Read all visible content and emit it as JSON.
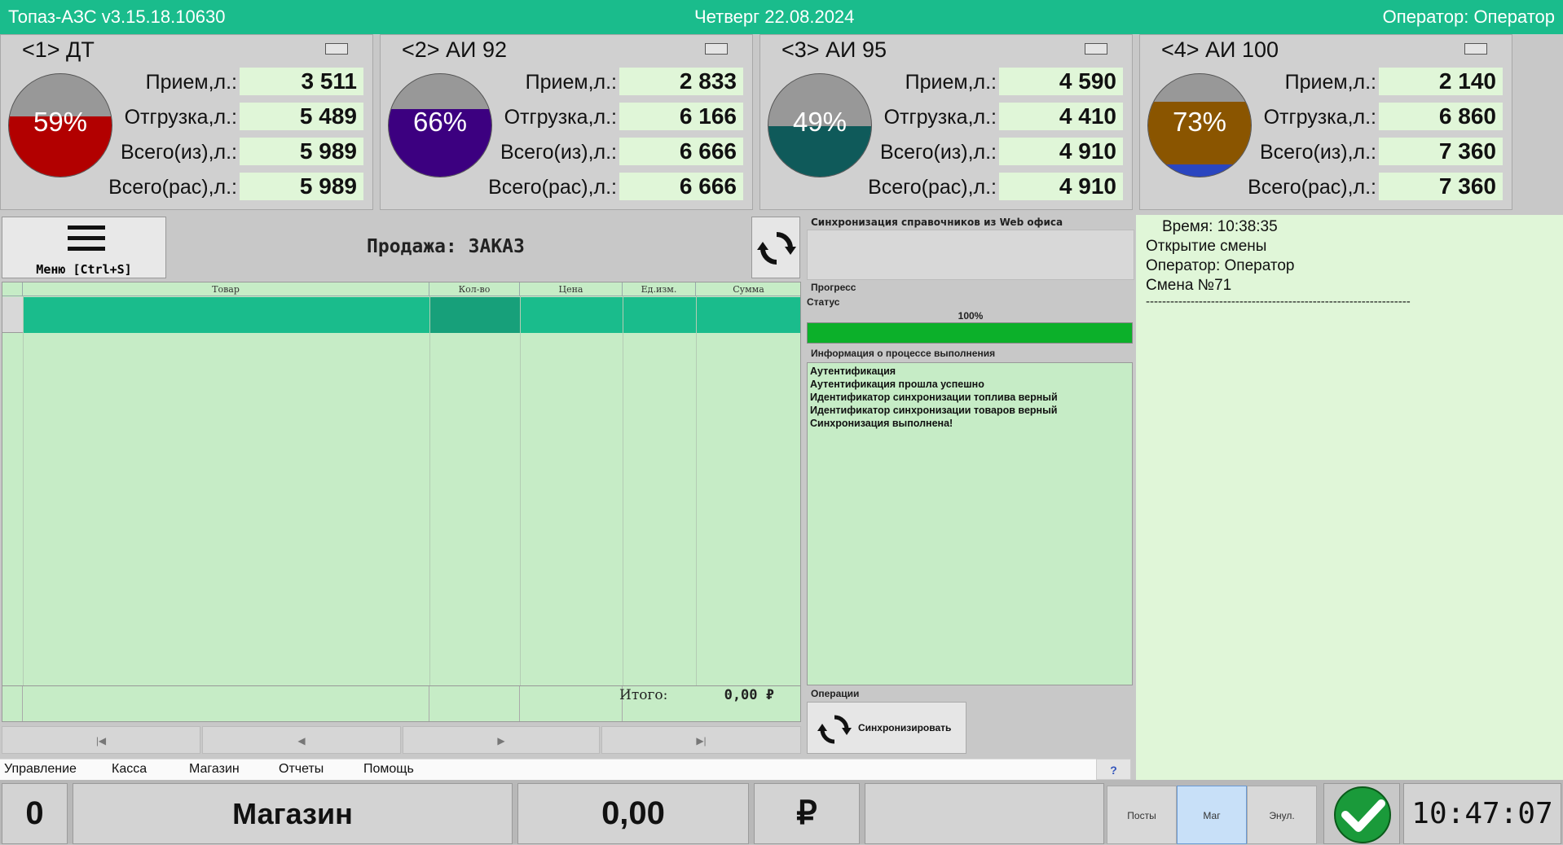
{
  "titlebar": {
    "app": "Топаз-АЗС  v3.15.18.10630",
    "date": "Четверг 22.08.2024",
    "operator": "Оператор: Оператор"
  },
  "tanks": [
    {
      "name": "<1> ДТ",
      "percent": "59%",
      "fill_color": "#b20000",
      "labels": [
        "Прием,л.:",
        "Отгрузка,л.:",
        "Всего(из),л.:",
        "Всего(рас),л.:"
      ],
      "values": [
        "3 511",
        "5 489",
        "5 989",
        "5 989"
      ]
    },
    {
      "name": "<2> АИ 92",
      "percent": "66%",
      "fill_color": "#3c0080",
      "labels": [
        "Прием,л.:",
        "Отгрузка,л.:",
        "Всего(из),л.:",
        "Всего(рас),л.:"
      ],
      "values": [
        "2 833",
        "6 166",
        "6 666",
        "6 666"
      ]
    },
    {
      "name": "<3> АИ 95",
      "percent": "49%",
      "fill_color": "#0f5a5a",
      "labels": [
        "Прием,л.:",
        "Отгрузка,л.:",
        "Всего(из),л.:",
        "Всего(рас),л.:"
      ],
      "values": [
        "4 590",
        "4 410",
        "4 910",
        "4 910"
      ]
    },
    {
      "name": "<4> АИ 100",
      "percent": "73%",
      "fill_color": "#8a5500",
      "water_color": "#2a46c0",
      "labels": [
        "Прием,л.:",
        "Отгрузка,л.:",
        "Всего(из),л.:",
        "Всего(рас),л.:"
      ],
      "values": [
        "2 140",
        "6 860",
        "7 360",
        "7 360"
      ]
    }
  ],
  "sale": {
    "menu_label": "Меню [Ctrl+S]",
    "title": "Продажа: ЗАКАЗ",
    "columns": [
      "Товар",
      "Кол-во",
      "Цена",
      "Ед.изм.",
      "Сумма"
    ],
    "total_label": "Итого:",
    "total_value": "0,00 ₽",
    "nav": [
      "|◀",
      "◀",
      "▶",
      "▶|"
    ]
  },
  "sync": {
    "header": "Синхронизация справочников из Web офиса",
    "progress_label": "Прогресс",
    "status_label": "Статус",
    "progress_text": "100%",
    "progress": 1.0,
    "info_label": "Информация о процессе выполнения",
    "log": [
      "Аутентификация",
      "Аутентификация прошла успешно",
      "Идентификатор синхронизации топлива верный",
      "Идентификатор синхронизации товаров верный",
      "Синхронизация выполнена!"
    ],
    "ops_label": "Операции",
    "sync_button": "Синхронизировать"
  },
  "shift_log": {
    "time": "Время: 10:38:35",
    "event": "Открытие смены",
    "operator": "Оператор: Оператор",
    "shift": "Смена №71",
    "separator": "-----------------------------------------------------------------"
  },
  "menubar": {
    "items": [
      "Управление",
      "Касса",
      "Магазин",
      "Отчеты",
      "Помощь"
    ],
    "help": "?"
  },
  "statusbar": {
    "count": "0",
    "mode": "Магазин",
    "amount": "0,00",
    "currency": "₽",
    "segments": [
      "Посты",
      "Маг",
      "Энул."
    ],
    "clock": "10:47:07"
  },
  "colors": {
    "accent": "#1abc8c",
    "grid_bg": "#c6ecc6",
    "log_bg": "#e0f6d8",
    "progress": "#0cb02a"
  }
}
